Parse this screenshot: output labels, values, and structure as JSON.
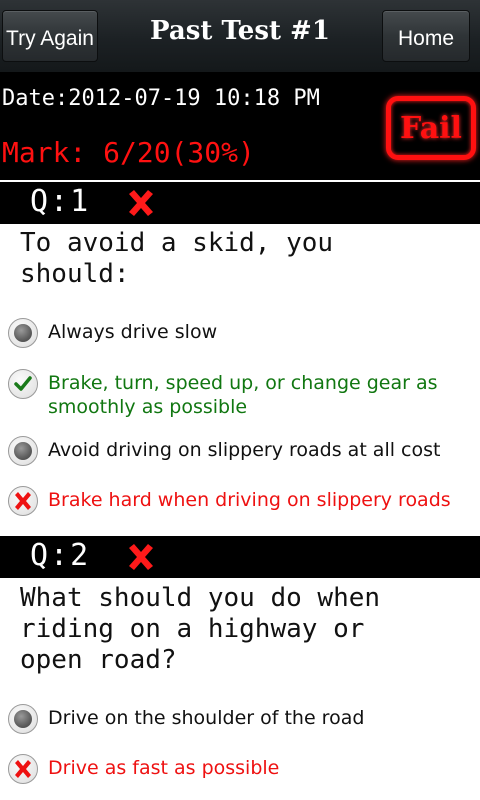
{
  "header": {
    "left_button": "Try Again",
    "title": "Past Test #1",
    "right_button": "Home"
  },
  "info": {
    "date": "Date:2012-07-19 10:18 PM",
    "mark": "Mark: 6/20(30%)",
    "result_badge": "Fail"
  },
  "colors": {
    "correct": "#117711",
    "wrong": "#ee1111",
    "badge": "#ff1010"
  },
  "questions": [
    {
      "label": "Q:1",
      "status_icon": "wrong-x-icon",
      "text": "To avoid a skid, you\nshould:",
      "options": [
        {
          "text": "Always drive slow",
          "state": "unselected"
        },
        {
          "text": "Brake, turn, speed up, or change gear as smoothly as possible",
          "state": "correct"
        },
        {
          "text": "Avoid driving on slippery roads at all cost",
          "state": "unselected"
        },
        {
          "text": "Brake hard when driving on slippery roads",
          "state": "wrong"
        }
      ]
    },
    {
      "label": "Q:2",
      "status_icon": "wrong-x-icon",
      "text": "What should you do when\nriding on a highway or\nopen road?",
      "options": [
        {
          "text": "Drive on the shoulder of the road",
          "state": "unselected"
        },
        {
          "text": "Drive as fast as possible",
          "state": "wrong"
        }
      ]
    }
  ]
}
